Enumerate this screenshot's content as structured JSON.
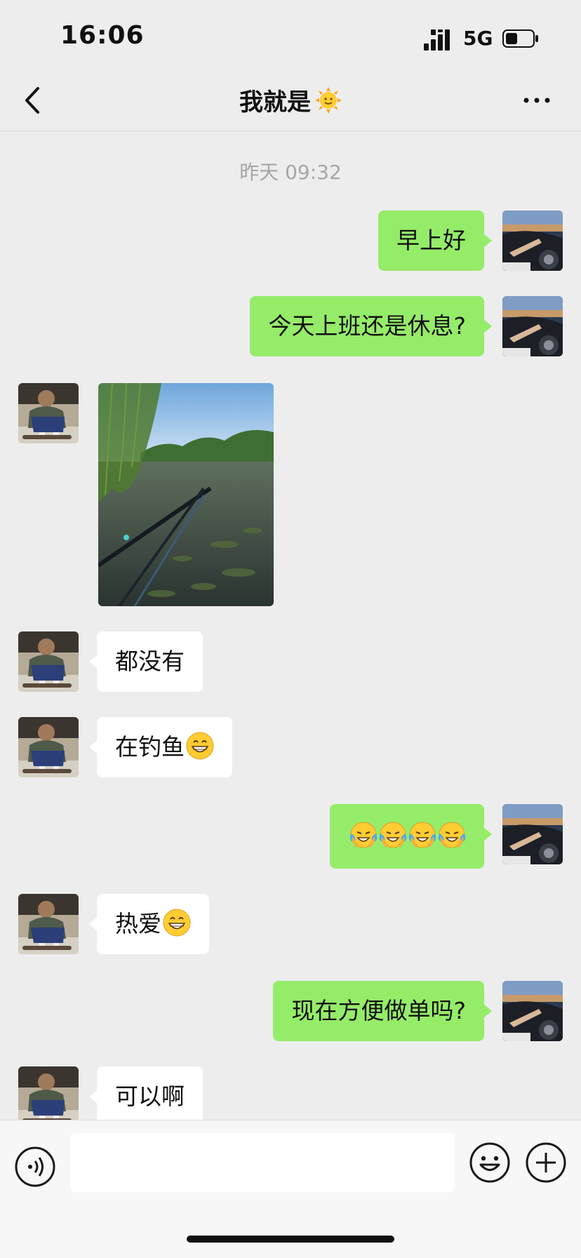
{
  "status_bar": {
    "time": "16:06",
    "network": "5G",
    "battery_level": 0.45
  },
  "header": {
    "title": "我就是",
    "title_icon": "sun-face-emoji"
  },
  "chat": {
    "timestamp": "昨天 09:32",
    "messages": [
      {
        "side": "me",
        "text": "早上好"
      },
      {
        "side": "me",
        "text": "今天上班还是休息?"
      },
      {
        "side": "other",
        "type": "image",
        "content": "fishing-lake-photo"
      },
      {
        "side": "other",
        "text": "都没有"
      },
      {
        "side": "other",
        "text": "在钓鱼",
        "emoji": "grinning-face-emoji"
      },
      {
        "side": "me",
        "text": "",
        "emojis": [
          "crying-laughing-emoji",
          "crying-laughing-emoji",
          "crying-laughing-emoji",
          "crying-laughing-emoji"
        ]
      },
      {
        "side": "other",
        "text": "热爱",
        "emoji": "grinning-face-emoji"
      },
      {
        "side": "me",
        "text": "现在方便做单吗?"
      },
      {
        "side": "other",
        "text": "可以啊"
      }
    ]
  },
  "input_bar": {
    "placeholder": "",
    "left_icon": "voice-icon",
    "right_icons": [
      "emoji-icon",
      "plus-icon"
    ]
  },
  "colors": {
    "my_bubble": "#95ec69",
    "their_bubble": "#ffffff",
    "background": "#ededed"
  }
}
